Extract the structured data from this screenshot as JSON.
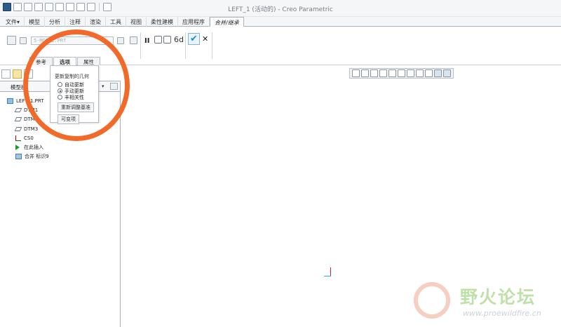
{
  "window": {
    "title": "LEFT_1 (活动的) - Creo Parametric"
  },
  "ribbon_tabs": [
    {
      "label": "文件▾"
    },
    {
      "label": "模型"
    },
    {
      "label": "分析"
    },
    {
      "label": "注释"
    },
    {
      "label": "渲染"
    },
    {
      "label": "工具"
    },
    {
      "label": "视图"
    },
    {
      "label": "柔性建模"
    },
    {
      "label": "应用程序"
    },
    {
      "label": "合并/继承"
    }
  ],
  "ribbon": {
    "reference_field": "5-MODEL.PRT",
    "ok_symbol": "✔",
    "cancel_symbol": "✕",
    "pause_symbol": "II",
    "glasses_symbol": "6d"
  },
  "dashboard_tabs": [
    {
      "label": "参考"
    },
    {
      "label": "选项"
    },
    {
      "label": "属性"
    }
  ],
  "options_panel": {
    "heading": "更新复制的几何",
    "radios": [
      {
        "label": "自动更新",
        "selected": false
      },
      {
        "label": "手动更新",
        "selected": true
      },
      {
        "label": "丰相关性",
        "selected": false
      }
    ],
    "button_reregen": "重新调整基准",
    "button_variable": "可变项"
  },
  "navigator": {
    "header": "模型树",
    "chevron": "▾",
    "tree": [
      {
        "label": "LEFT_1.PRT",
        "icon": "part-icon"
      },
      {
        "label": "DTM1",
        "icon": "datum-plane-icon"
      },
      {
        "label": "DTM2",
        "icon": "datum-plane-icon"
      },
      {
        "label": "DTM3",
        "icon": "datum-plane-icon"
      },
      {
        "label": "CS0",
        "icon": "coordinate-system-icon"
      },
      {
        "label": "在此插入",
        "icon": "insert-here-arrow-icon"
      },
      {
        "label": "合并 标识9",
        "icon": "merge-feature-icon"
      }
    ]
  },
  "watermark": {
    "text": "野火论坛",
    "url": "www.proewildfire.cn"
  },
  "colors": {
    "annotation_circle": "#f26a2a",
    "ok_check": "#1a8fd6",
    "triad_red": "#dd2222",
    "triad_cyan": "#2bb3c7"
  }
}
